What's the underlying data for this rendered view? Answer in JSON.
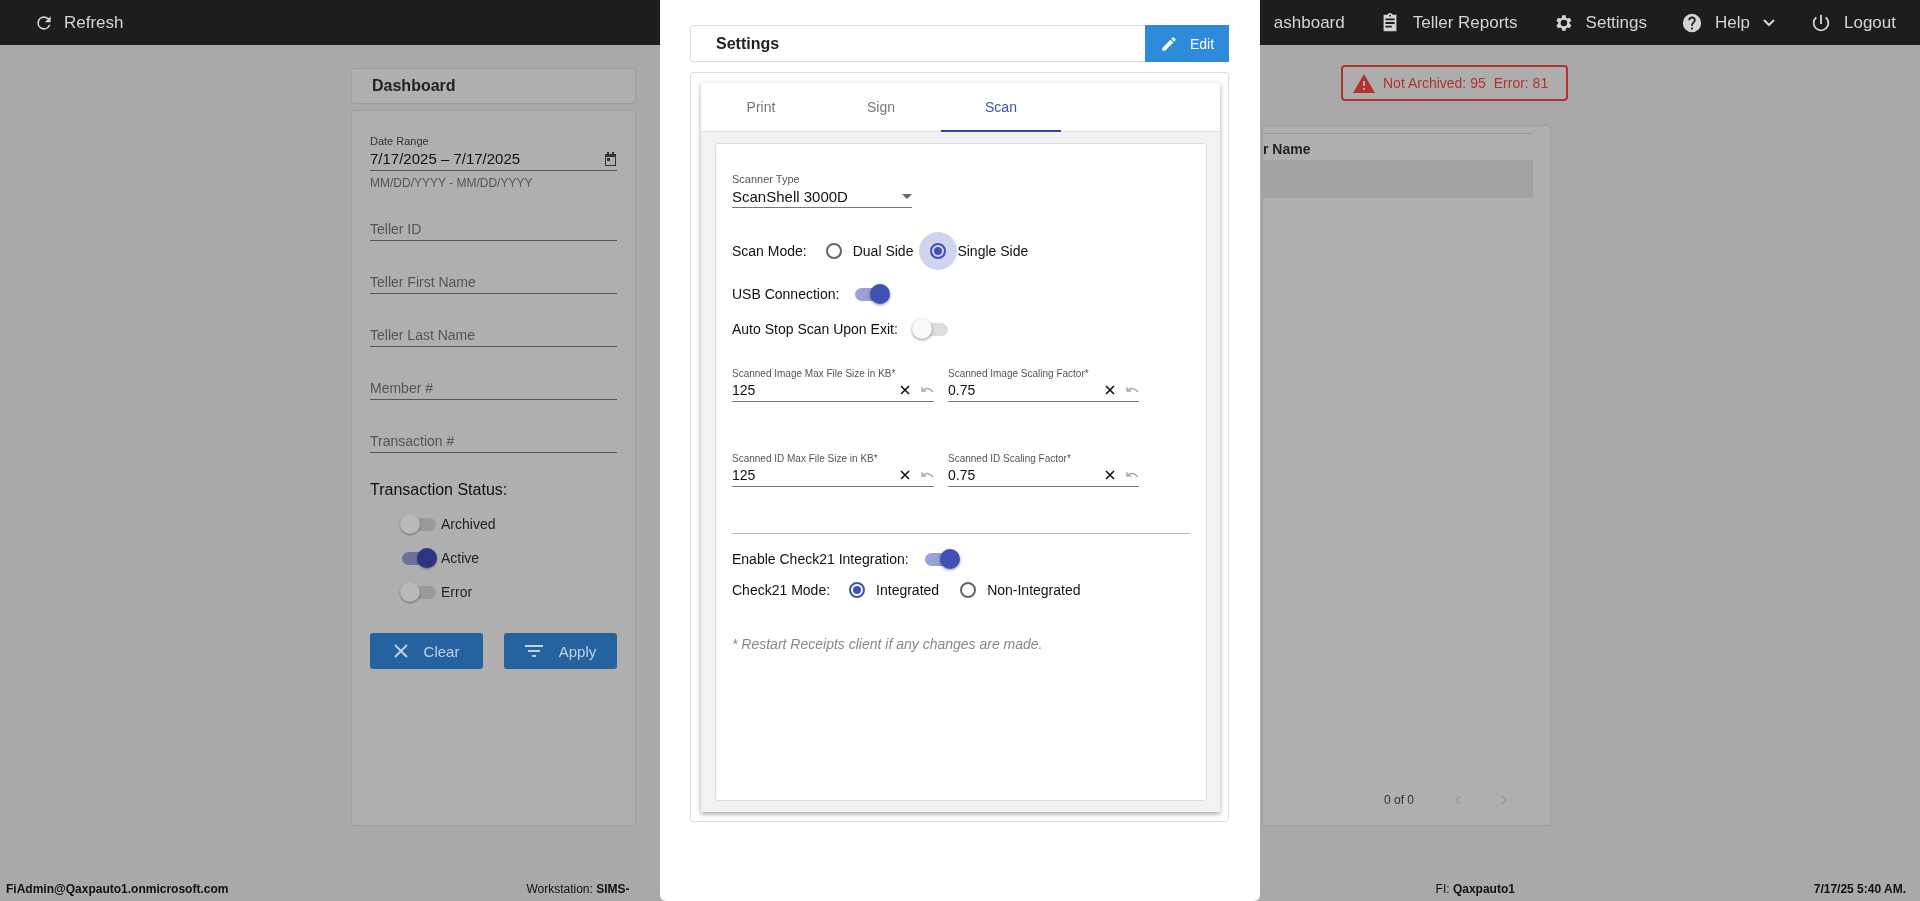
{
  "top_nav": {
    "refresh": "Refresh",
    "items": [
      {
        "label": "ashboard",
        "kind": "dashboard"
      },
      {
        "label": "Teller Reports",
        "kind": "reports"
      },
      {
        "label": "Settings",
        "kind": "settings"
      },
      {
        "label": "Help",
        "kind": "help"
      },
      {
        "label": "Logout",
        "kind": "logout"
      }
    ]
  },
  "dashboard_panel": {
    "title": "Dashboard"
  },
  "filters": {
    "date_range": {
      "label": "Date Range",
      "value": "7/17/2025 – 7/17/2025",
      "hint": "MM/DD/YYYY - MM/DD/YYYY"
    },
    "fields": [
      {
        "placeholder": "Teller ID"
      },
      {
        "placeholder": "Teller First Name"
      },
      {
        "placeholder": "Teller Last Name"
      },
      {
        "placeholder": "Member #"
      },
      {
        "placeholder": "Transaction #"
      }
    ],
    "status_label": "Transaction Status:",
    "statuses": [
      {
        "label": "Archived",
        "on": false
      },
      {
        "label": "Active",
        "on": true
      },
      {
        "label": "Error",
        "on": false
      }
    ],
    "buttons": [
      {
        "label": "Clear",
        "kind": "clear"
      },
      {
        "label": "Apply",
        "kind": "apply"
      }
    ]
  },
  "alert": {
    "items": [
      "Not Archived: 95",
      "Error: 81"
    ]
  },
  "table": {
    "columns": [
      "r Name"
    ],
    "pager": "0 of 0"
  },
  "settings_dialog": {
    "title": "Settings",
    "edit_button": "Edit",
    "tabs": [
      {
        "label": "Print",
        "selected": false
      },
      {
        "label": "Sign",
        "selected": false
      },
      {
        "label": "Scan",
        "selected": true
      }
    ],
    "scanner_type": {
      "label": "Scanner Type",
      "value": "ScanShell 3000D"
    },
    "scan_mode": {
      "label": "Scan Mode:",
      "options": [
        {
          "label": "Dual Side",
          "selected": false,
          "focused": false
        },
        {
          "label": "Single Side",
          "selected": true,
          "focused": true
        }
      ]
    },
    "switches": [
      {
        "label": "USB Connection:",
        "on": true
      },
      {
        "label": "Auto Stop Scan Upon Exit:",
        "on": false
      }
    ],
    "size_fields": [
      {
        "label": "Scanned Image Max File Size in KB*",
        "value": "125"
      },
      {
        "label": "Scanned Image Scaling Factor*",
        "value": "0.75"
      },
      {
        "label": "Scanned ID Max File Size in KB*",
        "value": "125"
      },
      {
        "label": "Scanned ID Scaling Factor*",
        "value": "0.75"
      }
    ],
    "check21_enable": {
      "label": "Enable Check21 Integration:",
      "on": true
    },
    "check21_mode": {
      "label": "Check21 Mode:",
      "options": [
        {
          "label": "Integrated",
          "selected": true,
          "focused": false
        },
        {
          "label": "Non-Integrated",
          "selected": false,
          "focused": false
        }
      ]
    },
    "note": "* Restart Receipts client if any changes are made."
  },
  "status_bar": {
    "user": "FiAdmin@Qaxpauto1.onmicrosoft.com",
    "workstation_label": "Workstation:",
    "workstation": "SIMS-",
    "fi_label": "FI:",
    "fi": "Qaxpauto1",
    "time": "7/17/25 5:40 AM."
  }
}
